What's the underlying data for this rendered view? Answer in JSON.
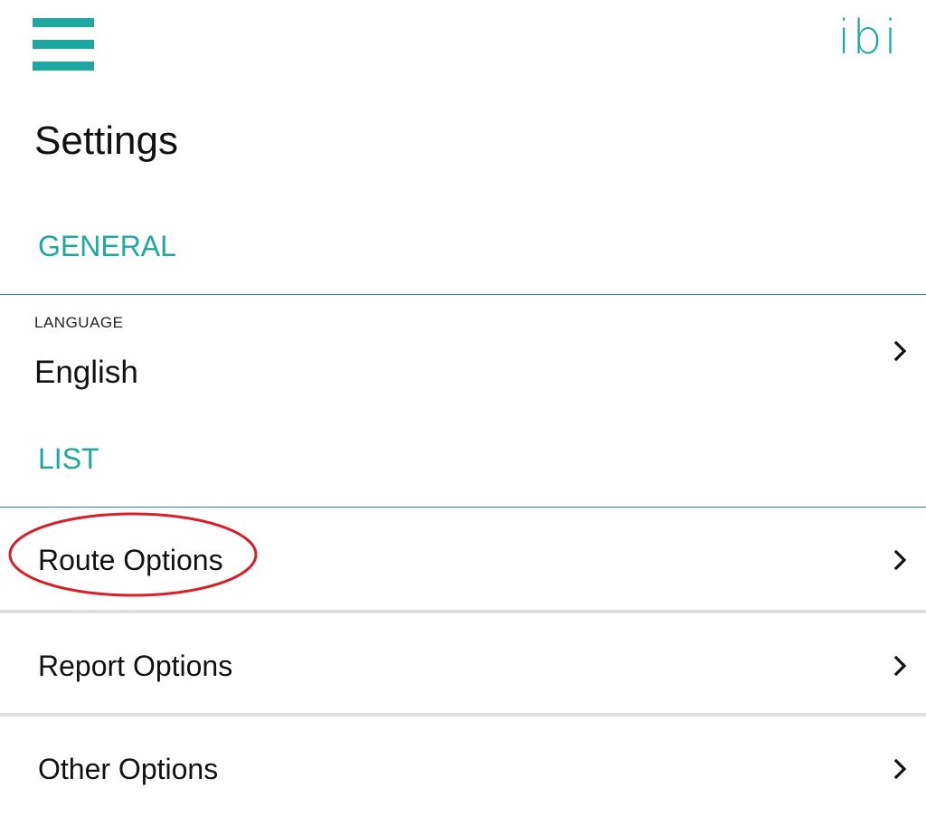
{
  "header": {
    "menu_icon": "hamburger-menu-icon",
    "logo_text": "ibi"
  },
  "page": {
    "title": "Settings"
  },
  "sections": {
    "general": {
      "header": "GENERAL",
      "language": {
        "caption": "LANGUAGE",
        "value": "English"
      }
    },
    "list": {
      "header": "LIST",
      "items": [
        {
          "label": "Route Options"
        },
        {
          "label": "Report Options"
        },
        {
          "label": "Other Options"
        }
      ]
    }
  },
  "icons": {
    "chevron": "chevron-right-icon"
  },
  "colors": {
    "accent": "#1fa7a1",
    "divider_teal": "#2a8f8a",
    "divider_gray": "#e0e0e0",
    "annotation": "#d71f2a",
    "text": "#111111"
  }
}
